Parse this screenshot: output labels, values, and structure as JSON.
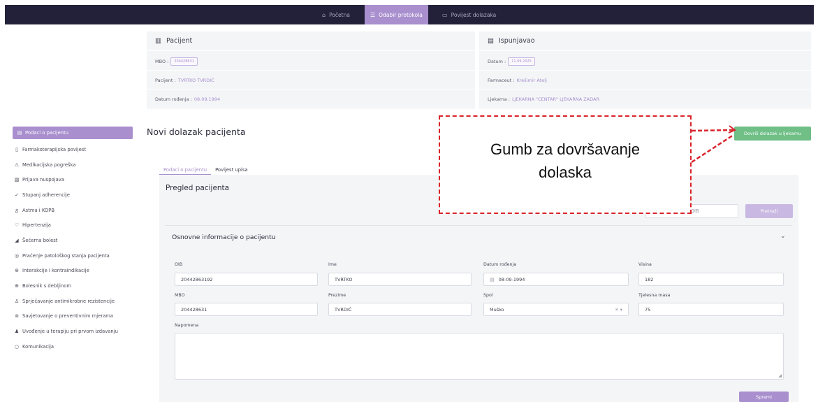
{
  "nav": {
    "items": [
      {
        "label": "Početna",
        "icon": "home-icon"
      },
      {
        "label": "Odabir protokola",
        "icon": "list-icon"
      },
      {
        "label": "Povijest dolazaka",
        "icon": "calendar-icon"
      }
    ]
  },
  "patient_card": {
    "title": "Pacijent",
    "mbo_label": "MBO :",
    "mbo_value": "204428631",
    "patient_label": "Pacijent :",
    "patient_value": "TVRTKO TVRDIĆ",
    "dob_label": "Datum rođenja :",
    "dob_value": "08.09.1994"
  },
  "filled_card": {
    "title": "Ispunjavao",
    "date_label": "Datum :",
    "date_value": "11.09.2025",
    "pharmacist_label": "Farmaceut :",
    "pharmacist_value": "Krešimir Atelj",
    "pharmacy_label": "Ljekarna :",
    "pharmacy_value": "LJEKARNA \"CENTAR\" LJEKARNA ZADAR"
  },
  "sidebar": {
    "items": [
      {
        "label": "Podaci o pacijentu",
        "icon": "list-icon"
      },
      {
        "label": "Farmakoterapijska povijest",
        "icon": "document-icon"
      },
      {
        "label": "Medikacijska pogreška",
        "icon": "warning-icon"
      },
      {
        "label": "Prijava nuspojava",
        "icon": "report-icon"
      },
      {
        "label": "Stupanj adherencije",
        "icon": "check-icon"
      },
      {
        "label": "Astma i KOPB",
        "icon": "lungs-icon"
      },
      {
        "label": "Hipertenzija",
        "icon": "heart-icon"
      },
      {
        "label": "Šećerna bolest",
        "icon": "drop-icon"
      },
      {
        "label": "Praćenje patološkog stanja pacijenta",
        "icon": "monitor-icon"
      },
      {
        "label": "Interakcije i kontraindikacije",
        "icon": "interaction-icon"
      },
      {
        "label": "Bolesnik s debljinom",
        "icon": "scale-icon"
      },
      {
        "label": "Sprječavanje antimikrobne rezistencije",
        "icon": "shield-icon"
      },
      {
        "label": "Savjetovanje o preventivnim mjerama",
        "icon": "advice-icon"
      },
      {
        "label": "Uvođenje u terapiju pri prvom izdavanju",
        "icon": "user-icon"
      },
      {
        "label": "Komunikacija",
        "icon": "chat-icon"
      }
    ]
  },
  "main": {
    "title": "Novi dolazak pacijenta",
    "finish_button": "Dovrši dolazak u ljekarnu",
    "tabs": [
      {
        "label": "Podaci o pacijentu"
      },
      {
        "label": "Povijest upisa"
      }
    ],
    "panel_title": "Pregled pacijenta",
    "search_placeholder": "Unesi MBO ili OIB",
    "search_button": "Pretraži",
    "section_title": "Osnovne informacije o pacijentu"
  },
  "form": {
    "oib_label": "OIB",
    "oib_value": "20442863192",
    "ime_label": "Ime",
    "ime_value": "TVRTKO",
    "dob_label": "Datum rođenja",
    "dob_value": "08-09-1994",
    "visina_label": "Visina",
    "visina_value": "182",
    "mbo_label": "MBO",
    "mbo_value": "204428631",
    "prezime_label": "Prezime",
    "prezime_value": "TVRDIĆ",
    "spol_label": "Spol",
    "spol_value": "Muško",
    "masa_label": "Tjelesna masa",
    "masa_value": "75",
    "napomena_label": "Napomena",
    "save_button": "Spremi"
  },
  "annotation": {
    "text_line1": "Gumb za dovršavanje",
    "text_line2": "dolaska",
    "color": "#d9242b"
  },
  "colors": {
    "nav_bg": "#23213a",
    "accent": "#a98fce",
    "success": "#6fbf87",
    "panel_bg": "#f3f5f7"
  }
}
